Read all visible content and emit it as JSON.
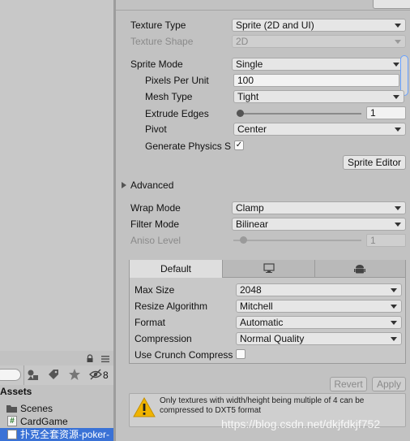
{
  "inspector": {
    "texture_type": {
      "label": "Texture Type",
      "value": "Sprite (2D and UI)"
    },
    "texture_shape": {
      "label": "Texture Shape",
      "value": "2D"
    },
    "sprite_mode": {
      "label": "Sprite Mode",
      "value": "Single"
    },
    "pixels_per_unit": {
      "label": "Pixels Per Unit",
      "value": "100"
    },
    "mesh_type": {
      "label": "Mesh Type",
      "value": "Tight"
    },
    "extrude_edges": {
      "label": "Extrude Edges",
      "value": "1",
      "fraction": 0.0
    },
    "pivot": {
      "label": "Pivot",
      "value": "Center"
    },
    "generate_physics": {
      "label": "Generate Physics S",
      "checked": true,
      "check_glyph": "✓"
    },
    "sprite_editor_button": "Sprite Editor",
    "advanced": {
      "label": "Advanced",
      "expanded": false
    },
    "wrap_mode": {
      "label": "Wrap Mode",
      "value": "Clamp"
    },
    "filter_mode": {
      "label": "Filter Mode",
      "value": "Bilinear"
    },
    "aniso_level": {
      "label": "Aniso Level",
      "value": "1",
      "fraction": 0.0
    }
  },
  "platform_tabs": [
    {
      "label": "Default",
      "active": true
    },
    {
      "icon": "monitor-icon",
      "active": false
    },
    {
      "icon": "android-icon",
      "active": false
    }
  ],
  "platform_settings": {
    "max_size": {
      "label": "Max Size",
      "value": "2048"
    },
    "resize_algorithm": {
      "label": "Resize Algorithm",
      "value": "Mitchell"
    },
    "format": {
      "label": "Format",
      "value": "Automatic"
    },
    "compression": {
      "label": "Compression",
      "value": "Normal Quality"
    },
    "use_crunch": {
      "label": "Use Crunch Compress",
      "checked": false
    }
  },
  "actions": {
    "revert": "Revert",
    "apply": "Apply"
  },
  "warning": {
    "icon": "warning-icon",
    "text": "Only textures with width/height being multiple of 4 can be compressed to DXT5 format"
  },
  "project": {
    "assets_label": "Assets",
    "hidden_count": "8",
    "items": [
      {
        "icon": "folder-icon",
        "label": "Scenes",
        "selected": false
      },
      {
        "icon": "script-icon",
        "icon_glyph": "#",
        "label": "CardGame",
        "selected": false
      },
      {
        "icon": "texture-icon",
        "label": "扑克全套资源-poker-",
        "selected": true
      }
    ]
  },
  "watermark": "https://blog.csdn.net/dkjfdkjf752",
  "colors": {
    "selection": "#3a72d6",
    "panel": "#c2c2c2",
    "warning": "#f0b400"
  }
}
